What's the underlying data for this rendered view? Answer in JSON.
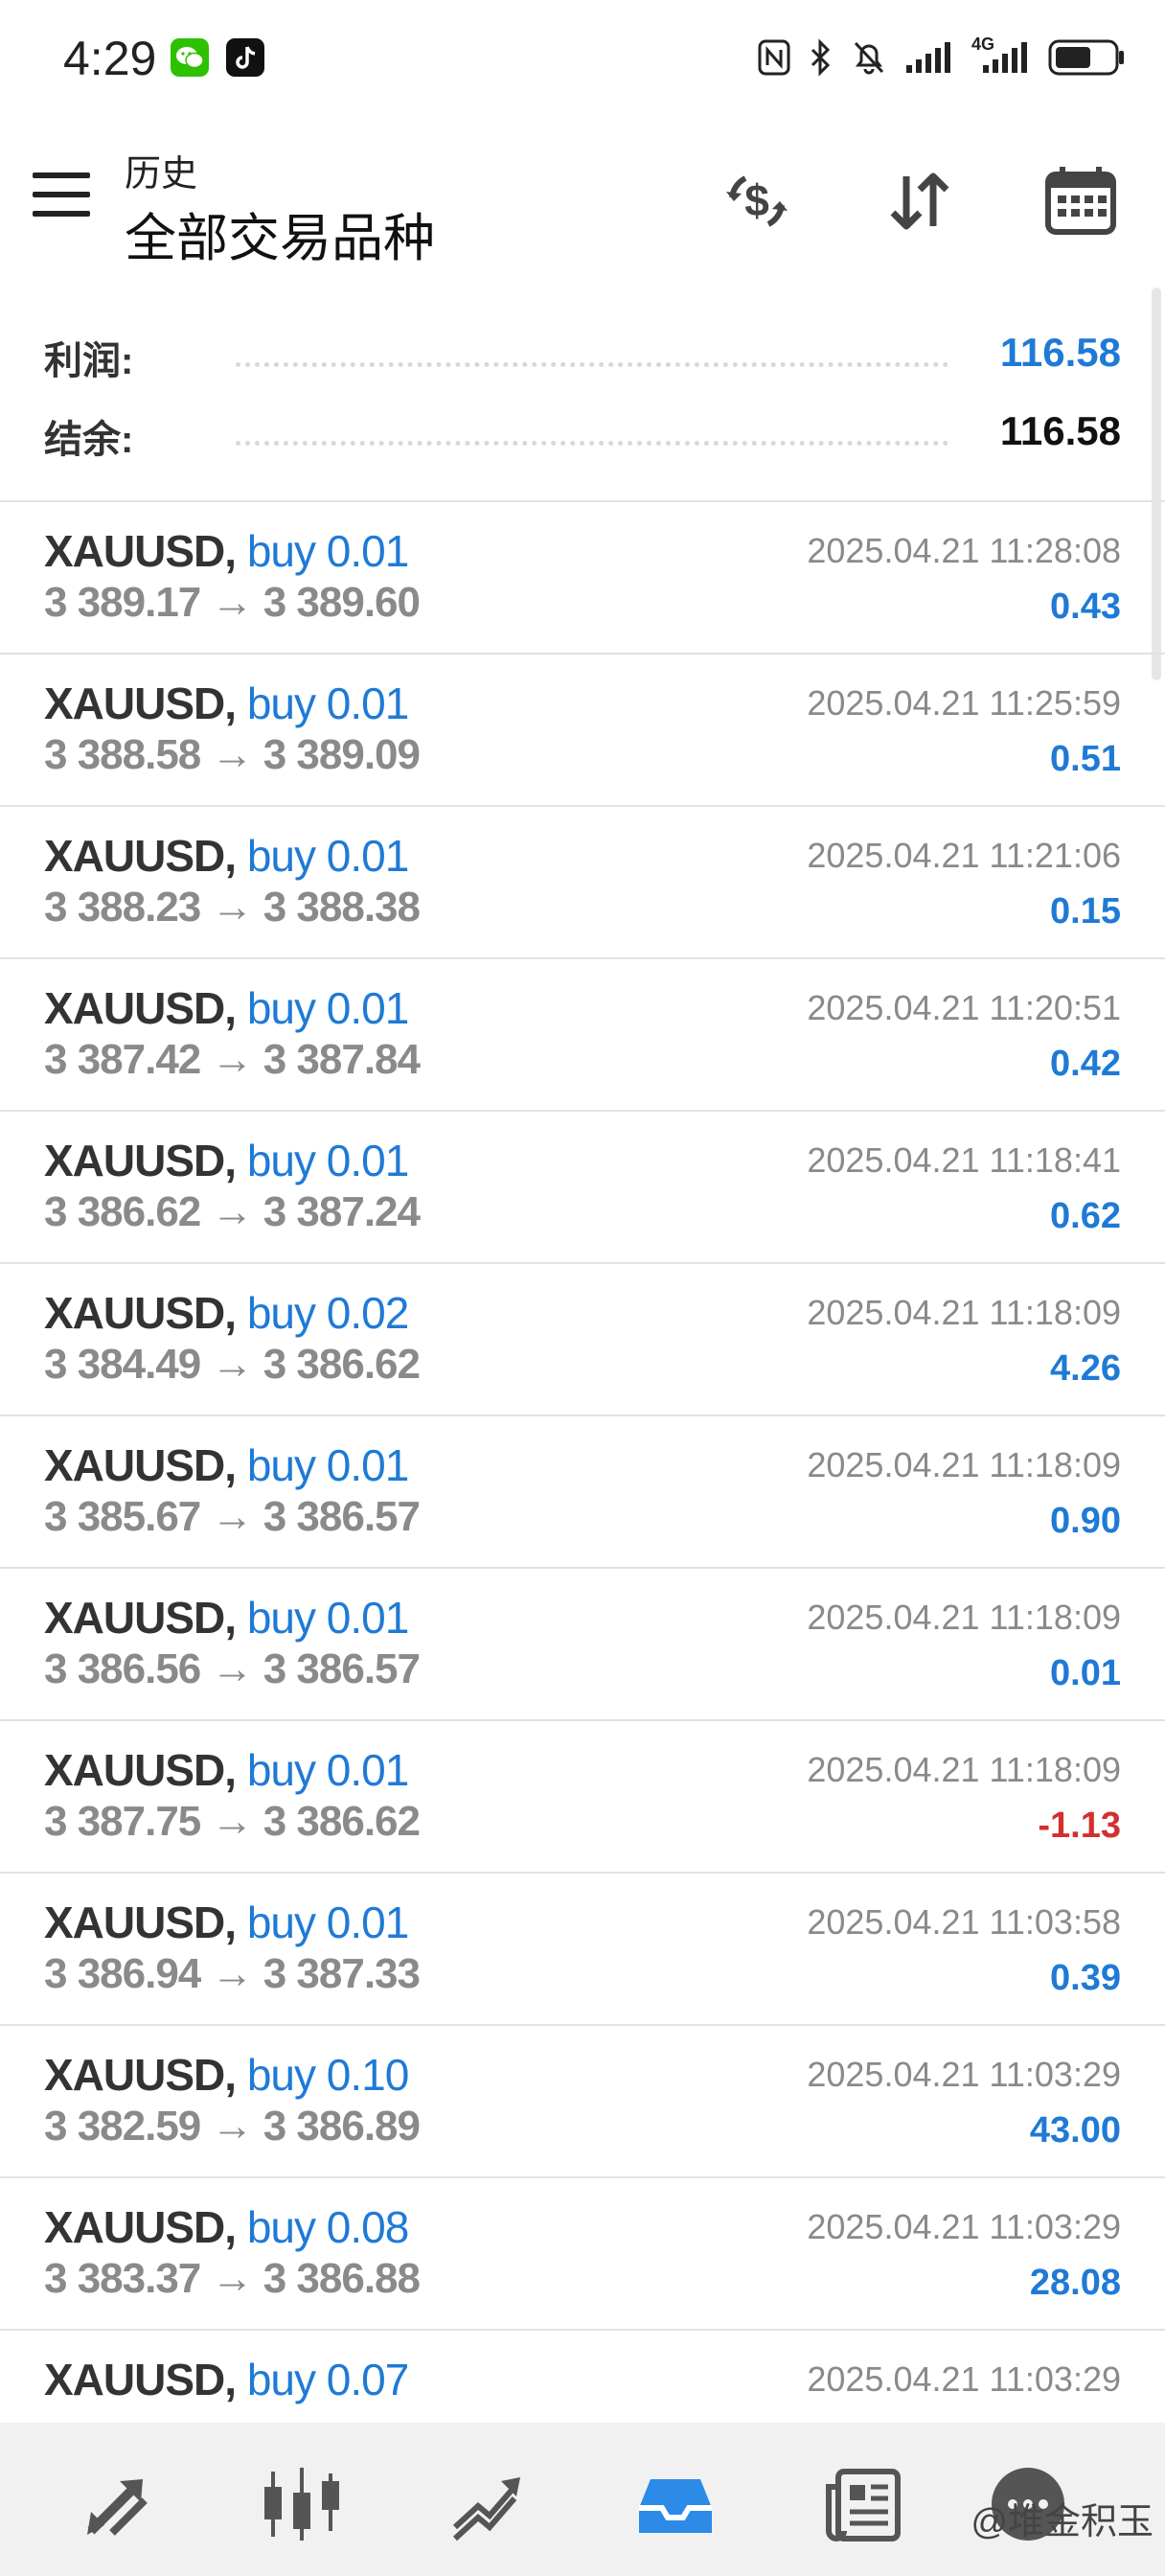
{
  "status_bar": {
    "time": "4:29",
    "apps": [
      "wechat-icon",
      "tiktok-icon"
    ],
    "indicators": [
      "nfc-icon",
      "bluetooth-icon",
      "mute-icon",
      "signal-icon",
      "4g-signal-icon",
      "battery-icon"
    ],
    "network_label": "4G"
  },
  "header": {
    "title": "历史",
    "subtitle": "全部交易品种",
    "actions": [
      "dollar-swap-icon",
      "sort-icon",
      "calendar-icon"
    ]
  },
  "summary": {
    "profit_label": "利润:",
    "profit_value": "116.58",
    "balance_label": "结余:",
    "balance_value": "116.58"
  },
  "colors": {
    "accent": "#1f7ad6",
    "loss": "#d32f2f",
    "text_secondary": "#8a8a8a"
  },
  "trades": [
    {
      "symbol": "XAUUSD,",
      "side": "buy 0.01",
      "prices": "3 389.17 → 3 389.60",
      "time": "2025.04.21 11:28:08",
      "profit": "0.43",
      "negative": false
    },
    {
      "symbol": "XAUUSD,",
      "side": "buy 0.01",
      "prices": "3 388.58 → 3 389.09",
      "time": "2025.04.21 11:25:59",
      "profit": "0.51",
      "negative": false
    },
    {
      "symbol": "XAUUSD,",
      "side": "buy 0.01",
      "prices": "3 388.23 → 3 388.38",
      "time": "2025.04.21 11:21:06",
      "profit": "0.15",
      "negative": false
    },
    {
      "symbol": "XAUUSD,",
      "side": "buy 0.01",
      "prices": "3 387.42 → 3 387.84",
      "time": "2025.04.21 11:20:51",
      "profit": "0.42",
      "negative": false
    },
    {
      "symbol": "XAUUSD,",
      "side": "buy 0.01",
      "prices": "3 386.62 → 3 387.24",
      "time": "2025.04.21 11:18:41",
      "profit": "0.62",
      "negative": false
    },
    {
      "symbol": "XAUUSD,",
      "side": "buy 0.02",
      "prices": "3 384.49 → 3 386.62",
      "time": "2025.04.21 11:18:09",
      "profit": "4.26",
      "negative": false
    },
    {
      "symbol": "XAUUSD,",
      "side": "buy 0.01",
      "prices": "3 385.67 → 3 386.57",
      "time": "2025.04.21 11:18:09",
      "profit": "0.90",
      "negative": false
    },
    {
      "symbol": "XAUUSD,",
      "side": "buy 0.01",
      "prices": "3 386.56 → 3 386.57",
      "time": "2025.04.21 11:18:09",
      "profit": "0.01",
      "negative": false
    },
    {
      "symbol": "XAUUSD,",
      "side": "buy 0.01",
      "prices": "3 387.75 → 3 386.62",
      "time": "2025.04.21 11:18:09",
      "profit": "-1.13",
      "negative": true
    },
    {
      "symbol": "XAUUSD,",
      "side": "buy 0.01",
      "prices": "3 386.94 → 3 387.33",
      "time": "2025.04.21 11:03:58",
      "profit": "0.39",
      "negative": false
    },
    {
      "symbol": "XAUUSD,",
      "side": "buy 0.10",
      "prices": "3 382.59 → 3 386.89",
      "time": "2025.04.21 11:03:29",
      "profit": "43.00",
      "negative": false
    },
    {
      "symbol": "XAUUSD,",
      "side": "buy 0.08",
      "prices": "3 383.37 → 3 386.88",
      "time": "2025.04.21 11:03:29",
      "profit": "28.08",
      "negative": false
    },
    {
      "symbol": "XAUUSD,",
      "side": "buy 0.07",
      "prices": "",
      "time": "2025.04.21 11:03:29",
      "profit": "",
      "negative": false
    }
  ],
  "bottom_nav": {
    "items": [
      "quotes-icon",
      "chart-icon",
      "trade-icon",
      "history-icon",
      "news-icon",
      "chat-icon"
    ],
    "active": "history-icon",
    "watermark": "@堆金积玉"
  }
}
